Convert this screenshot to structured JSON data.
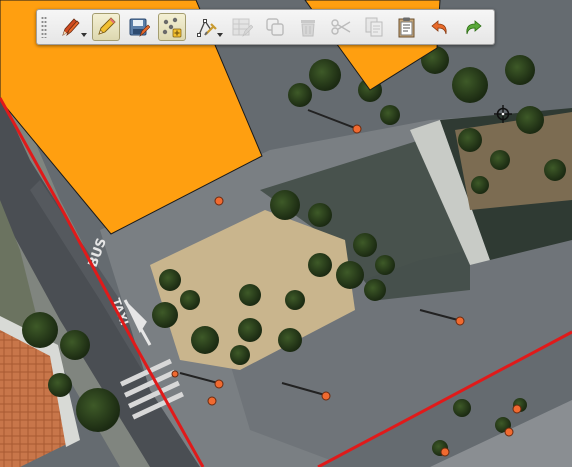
{
  "window": {
    "title": ""
  },
  "toolbar": {
    "buttons": [
      {
        "id": "current-edits",
        "icon": "pencils-icon",
        "has_dropdown": true,
        "active": false,
        "enabled": true
      },
      {
        "id": "toggle-editing",
        "icon": "pencil-icon",
        "has_dropdown": false,
        "active": true,
        "enabled": true
      },
      {
        "id": "save-layer-edits",
        "icon": "save-edits-icon",
        "has_dropdown": false,
        "active": false,
        "enabled": true
      },
      {
        "id": "add-point-feature",
        "icon": "add-point-icon",
        "has_dropdown": false,
        "active": true,
        "enabled": true
      },
      {
        "id": "vertex-tool",
        "icon": "vertex-tool-icon",
        "has_dropdown": true,
        "active": false,
        "enabled": true
      },
      {
        "id": "modify-attributes",
        "icon": "table-edit-icon",
        "has_dropdown": false,
        "active": false,
        "enabled": false
      },
      {
        "id": "copy-move",
        "icon": "copy-move-icon",
        "has_dropdown": false,
        "active": false,
        "enabled": false
      },
      {
        "id": "delete-selected",
        "icon": "trash-icon",
        "has_dropdown": false,
        "active": false,
        "enabled": false
      },
      {
        "id": "cut-features",
        "icon": "scissors-icon",
        "has_dropdown": false,
        "active": false,
        "enabled": false
      },
      {
        "id": "copy-features",
        "icon": "copy-icon",
        "has_dropdown": false,
        "active": false,
        "enabled": false
      },
      {
        "id": "paste-features",
        "icon": "paste-icon",
        "has_dropdown": false,
        "active": false,
        "enabled": true
      },
      {
        "id": "undo",
        "icon": "undo-icon",
        "has_dropdown": false,
        "active": false,
        "enabled": true
      },
      {
        "id": "redo",
        "icon": "redo-icon",
        "has_dropdown": false,
        "active": false,
        "enabled": true
      }
    ]
  },
  "map": {
    "road_markings": [
      "BUS",
      "TAXI"
    ],
    "colors": {
      "polygon_fill": "#ff9f10",
      "polygon_stroke": "#1a1a1a",
      "point_fill": "#f06a30",
      "line_color": "#e01a1a",
      "toolbar_active": "#ece6c0"
    },
    "points_count": 10,
    "polygons_count": 2,
    "lines_count": 2
  },
  "cursor": {
    "icon": "crosshair-cursor-icon"
  }
}
